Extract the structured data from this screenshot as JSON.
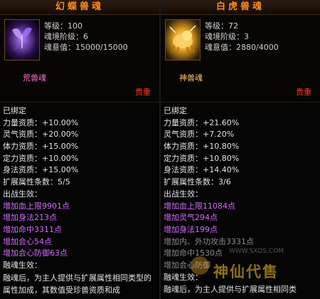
{
  "left": {
    "title": "幻蝶兽魂",
    "level": "等级：100",
    "soul_stage": "魂境阶级：6",
    "soul_value": "魂意值：15000/15000",
    "soul_name": "荒兽魂",
    "rarity": "贵重",
    "bound": "已绑定",
    "attributes": [
      "力量资质：+10.00%",
      "灵气资质：+20.00%",
      "体力资质：+15.00%",
      "定力资质：+10.00%",
      "身法资质：+15.00%"
    ],
    "ext_count": "扩展属性条数：5/5",
    "battle_effect_title": "出战生效：",
    "battle_effects": [
      {
        "text": "增加血上限9901点",
        "active": true
      },
      {
        "text": "增加身法213点",
        "active": true
      },
      {
        "text": "增加命中3311点",
        "active": true
      },
      {
        "text": "增加会心54点",
        "active": true
      },
      {
        "text": "增加会心防御63点",
        "active": true
      }
    ],
    "fuse_title": "融魂生效：",
    "fuse_desc": "融魂后，为主人提供与扩展属性相同类型的属性加成，其数值受珍兽资质和成"
  },
  "right": {
    "title": "白虎兽魂",
    "level": "等级：72",
    "soul_stage": "魂境阶级：3",
    "soul_value": "魂意值：2880/4000",
    "soul_name": "神兽魂",
    "rarity": "贵重",
    "bound": "已绑定",
    "attributes": [
      "力量资质：+21.60%",
      "灵气资质：+7.20%",
      "体力资质：+10.80%",
      "定力资质：+10.80%",
      "身法资质：+14.40%"
    ],
    "ext_count": "扩展属性条数：3/6",
    "battle_effect_title": "出战生效：",
    "battle_effects": [
      {
        "text": "增加血上限11084点",
        "active": true
      },
      {
        "text": "增加灵气294点",
        "active": true
      },
      {
        "text": "增加身法199点",
        "active": true
      },
      {
        "text": "增加内、外功攻击3331点",
        "active": false
      },
      {
        "text": "增加命中1530点",
        "active": false
      },
      {
        "text": "增加会心防御",
        "active": false
      }
    ],
    "fuse_title": "融魂生效：",
    "fuse_desc": "融魂后，为主人提供与扩展属性相同类"
  },
  "watermark": {
    "text": "神仙代售",
    "url": "WWW.SXDS.COM"
  },
  "colors": {
    "title": "#ff8a1c",
    "rarity": "#ff3b2a",
    "effect_active": "#d36bff",
    "effect_inactive": "#8b8b8b",
    "soul_name_left": "#ff6bd0",
    "soul_name_right": "#ffc36a"
  }
}
